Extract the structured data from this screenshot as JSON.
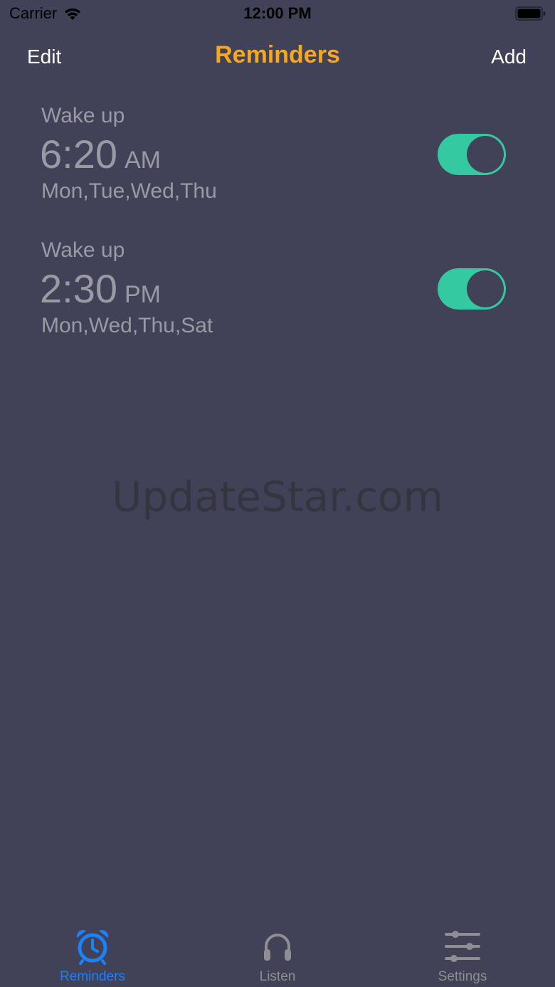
{
  "status_bar": {
    "carrier": "Carrier",
    "time": "12:00 PM"
  },
  "nav": {
    "edit_label": "Edit",
    "title": "Reminders",
    "add_label": "Add"
  },
  "reminders": [
    {
      "name": "Wake up",
      "time": "6:20",
      "ampm": "AM",
      "days": "Mon,Tue,Wed,Thu",
      "enabled": true
    },
    {
      "name": "Wake up",
      "time": "2:30",
      "ampm": "PM",
      "days": "Mon,Wed,Thu,Sat",
      "enabled": true
    }
  ],
  "watermark": "UpdateStar.com",
  "tabs": [
    {
      "label": "Reminders",
      "icon": "alarm-clock-icon",
      "active": true
    },
    {
      "label": "Listen",
      "icon": "headphones-icon",
      "active": false
    },
    {
      "label": "Settings",
      "icon": "sliders-icon",
      "active": false
    }
  ],
  "colors": {
    "background": "#414257",
    "title": "#f5a623",
    "toggle_on": "#34c9a0",
    "tab_active": "#1a82fb",
    "tab_inactive": "#8e8e93",
    "secondary_text": "#9a9aa4"
  }
}
